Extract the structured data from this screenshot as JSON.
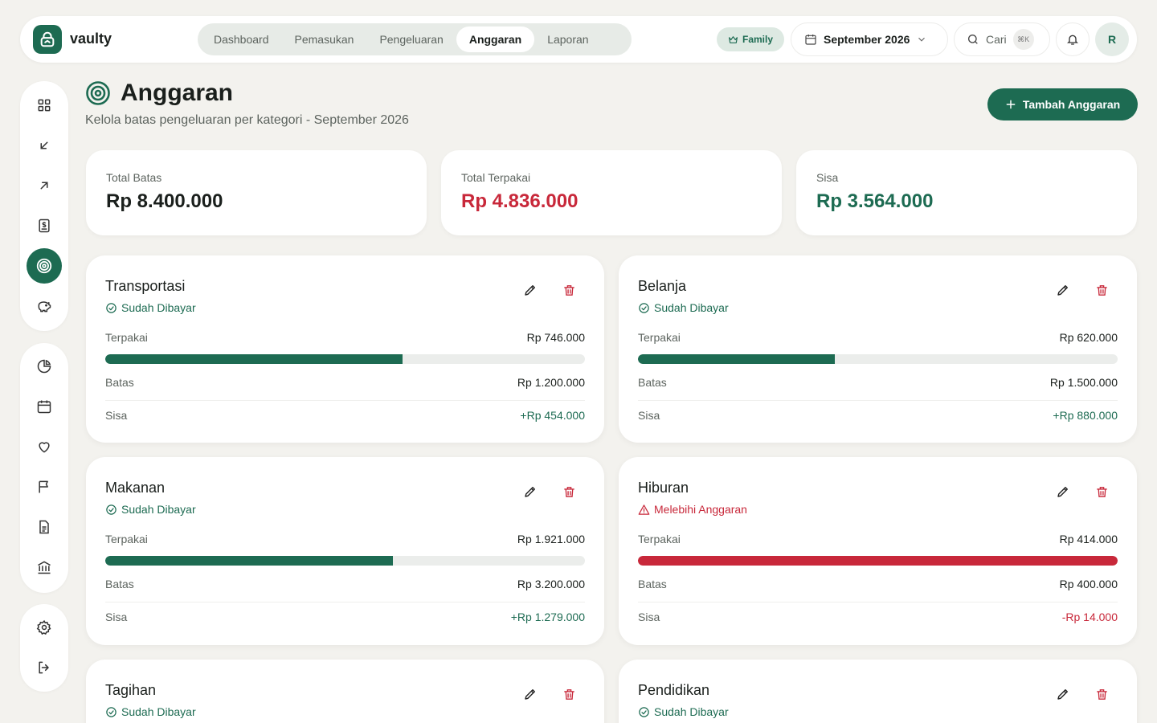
{
  "app": {
    "name": "vaulty"
  },
  "nav": {
    "tabs": [
      {
        "label": "Dashboard"
      },
      {
        "label": "Pemasukan"
      },
      {
        "label": "Pengeluaran"
      },
      {
        "label": "Anggaran"
      },
      {
        "label": "Laporan"
      }
    ],
    "active": "Anggaran"
  },
  "topbar": {
    "plan_badge": "Family",
    "month": "September 2026",
    "search_label": "Cari",
    "search_shortcut": "⌘K",
    "avatar_initial": "R"
  },
  "header": {
    "title": "Anggaran",
    "subtitle": "Kelola batas pengeluaran per kategori - September 2026",
    "add_button": "Tambah Anggaran"
  },
  "summary": [
    {
      "label": "Total Batas",
      "value": "Rp 8.400.000",
      "color": "#1a1f1c"
    },
    {
      "label": "Total Terpakai",
      "value": "Rp 4.836.000",
      "color": "#c8283a"
    },
    {
      "label": "Sisa",
      "value": "Rp 3.564.000",
      "color": "#1d6b52"
    }
  ],
  "labels": {
    "used": "Terpakai",
    "limit": "Batas",
    "remaining": "Sisa"
  },
  "budgets": [
    {
      "name": "Transportasi",
      "status": "Sudah Dibayar",
      "status_type": "ok",
      "used": "Rp 746.000",
      "limit": "Rp 1.200.000",
      "remaining": "+Rp 454.000",
      "progress": 0.62
    },
    {
      "name": "Belanja",
      "status": "Sudah Dibayar",
      "status_type": "ok",
      "used": "Rp 620.000",
      "limit": "Rp 1.500.000",
      "remaining": "+Rp 880.000",
      "progress": 0.41
    },
    {
      "name": "Makanan",
      "status": "Sudah Dibayar",
      "status_type": "ok",
      "used": "Rp 1.921.000",
      "limit": "Rp 3.200.000",
      "remaining": "+Rp 1.279.000",
      "progress": 0.6
    },
    {
      "name": "Hiburan",
      "status": "Melebihi Anggaran",
      "status_type": "over",
      "used": "Rp 414.000",
      "limit": "Rp 400.000",
      "remaining": "-Rp 14.000",
      "progress": 1.0
    },
    {
      "name": "Tagihan",
      "status": "Sudah Dibayar",
      "status_type": "ok"
    },
    {
      "name": "Pendidikan",
      "status": "Sudah Dibayar",
      "status_type": "ok"
    }
  ],
  "colors": {
    "brand": "#1d6b52",
    "danger": "#c8283a",
    "background": "#f3f2ee"
  },
  "sidebar": {
    "items": [
      {
        "icon": "grid-icon"
      },
      {
        "icon": "arrow-down-left-icon"
      },
      {
        "icon": "arrow-up-right-icon"
      },
      {
        "icon": "dollar-doc-icon"
      },
      {
        "icon": "target-icon",
        "active": true
      },
      {
        "icon": "piggy-bank-icon"
      },
      {
        "icon": "pie-chart-icon"
      },
      {
        "icon": "calendar-icon"
      },
      {
        "icon": "heart-icon"
      },
      {
        "icon": "flag-icon"
      },
      {
        "icon": "document-icon"
      },
      {
        "icon": "bank-icon"
      },
      {
        "icon": "gear-icon"
      },
      {
        "icon": "logout-icon"
      }
    ]
  }
}
